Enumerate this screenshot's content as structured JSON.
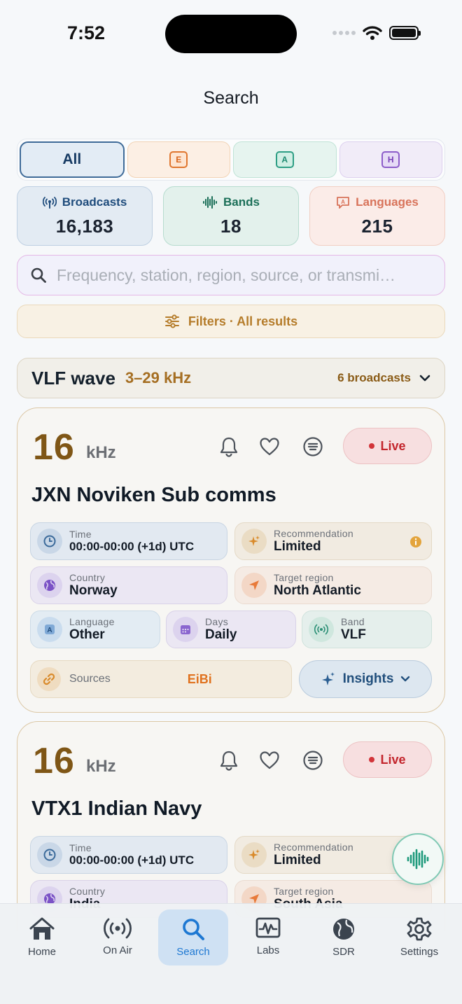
{
  "status_bar": {
    "time": "7:52"
  },
  "page": {
    "title": "Search"
  },
  "segments": [
    {
      "label": "All",
      "active": true
    },
    {
      "label": "E"
    },
    {
      "label": "A"
    },
    {
      "label": "H"
    }
  ],
  "stats": {
    "broadcasts": {
      "label": "Broadcasts",
      "value": "16,183"
    },
    "bands": {
      "label": "Bands",
      "value": "18"
    },
    "languages": {
      "label": "Languages",
      "value": "215"
    }
  },
  "search": {
    "placeholder": "Frequency, station, region, source, or transmi…",
    "value": ""
  },
  "filters": {
    "label": "Filters · All results"
  },
  "band_header": {
    "name": "VLF wave",
    "range": "3–29 kHz",
    "count": "6 broadcasts"
  },
  "broadcasts": [
    {
      "frequency": "16",
      "unit": "kHz",
      "status": "Live",
      "station": "JXN Noviken Sub comms",
      "time": {
        "label": "Time",
        "value": "00:00-00:00 (+1d) UTC"
      },
      "recommendation": {
        "label": "Recommendation",
        "value": "Limited"
      },
      "country": {
        "label": "Country",
        "value": "Norway"
      },
      "target_region": {
        "label": "Target region",
        "value": "North Atlantic"
      },
      "language": {
        "label": "Language",
        "value": "Other"
      },
      "days": {
        "label": "Days",
        "value": "Daily"
      },
      "band": {
        "label": "Band",
        "value": "VLF"
      },
      "sources": {
        "label": "Sources",
        "value": "EiBi"
      },
      "insights_label": "Insights"
    },
    {
      "frequency": "16",
      "unit": "kHz",
      "status": "Live",
      "station": "VTX1 Indian Navy",
      "time": {
        "label": "Time",
        "value": "00:00-00:00 (+1d) UTC"
      },
      "recommendation": {
        "label": "Recommendation",
        "value": "Limited"
      },
      "country": {
        "label": "Country",
        "value": "India"
      },
      "target_region": {
        "label": "Target region",
        "value": "South Asia"
      }
    }
  ],
  "tabs": [
    {
      "label": "Home",
      "icon": "home-icon"
    },
    {
      "label": "On Air",
      "icon": "antenna-icon"
    },
    {
      "label": "Search",
      "icon": "search-icon",
      "active": true
    },
    {
      "label": "Labs",
      "icon": "waveform-chart-icon"
    },
    {
      "label": "SDR",
      "icon": "globe-icon"
    },
    {
      "label": "Settings",
      "icon": "gear-icon"
    }
  ],
  "colors": {
    "accent": "#1e78d2",
    "frequency": "#7f5616",
    "live": "#c3262d",
    "card_border": "#dcc8a6"
  }
}
